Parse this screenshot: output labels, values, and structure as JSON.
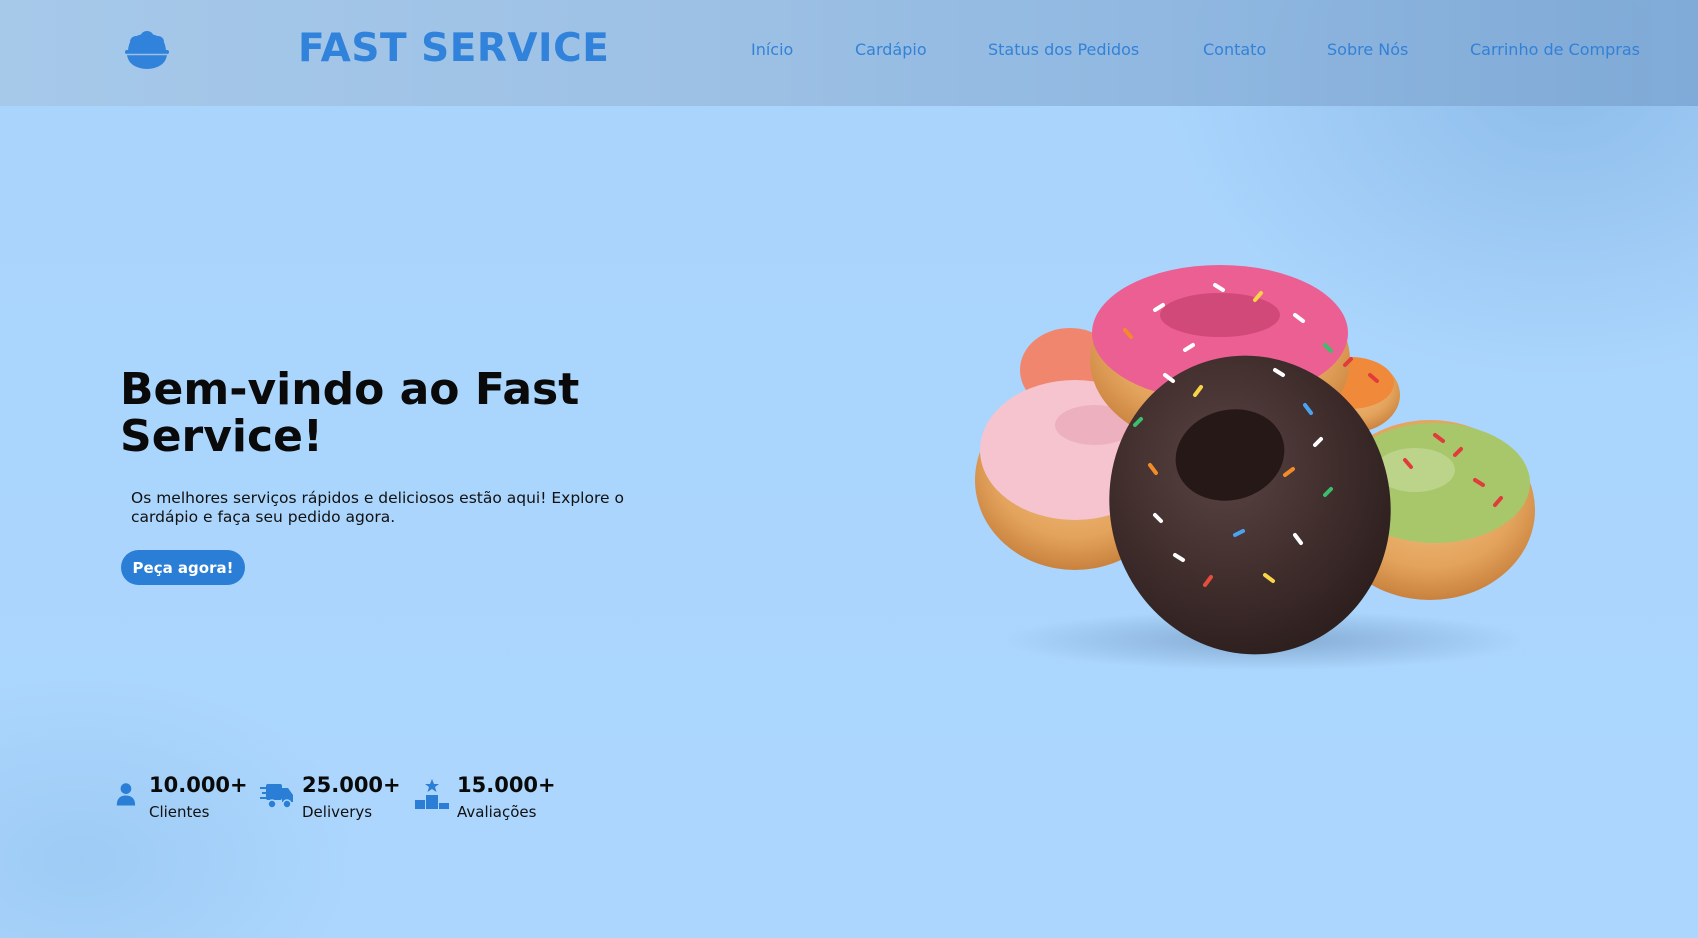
{
  "brand": {
    "name": "FAST SERVICE",
    "logo_icon": "food-bowl-icon",
    "color": "#2c7fd9"
  },
  "nav": {
    "items": [
      {
        "label": "Início"
      },
      {
        "label": "Cardápio"
      },
      {
        "label": "Status dos Pedidos"
      },
      {
        "label": "Contato"
      },
      {
        "label": "Sobre Nós"
      },
      {
        "label": "Carrinho de Compras"
      }
    ]
  },
  "hero": {
    "title": "Bem-vindo ao Fast Service!",
    "subtitle": "Os melhores serviços rápidos e deliciosos estão aqui! Explore o cardápio e faça seu pedido agora.",
    "cta_label": "Peça agora!",
    "image": "donuts-stack-image"
  },
  "stats": [
    {
      "icon": "user-icon",
      "value": "10.000+",
      "label": "Clientes"
    },
    {
      "icon": "delivery-truck-icon",
      "value": "25.000+",
      "label": "Deliverys"
    },
    {
      "icon": "podium-star-icon",
      "value": "15.000+",
      "label": "Avaliações"
    }
  ],
  "colors": {
    "accent": "#2a7ed6",
    "background": "#aad5fd"
  }
}
